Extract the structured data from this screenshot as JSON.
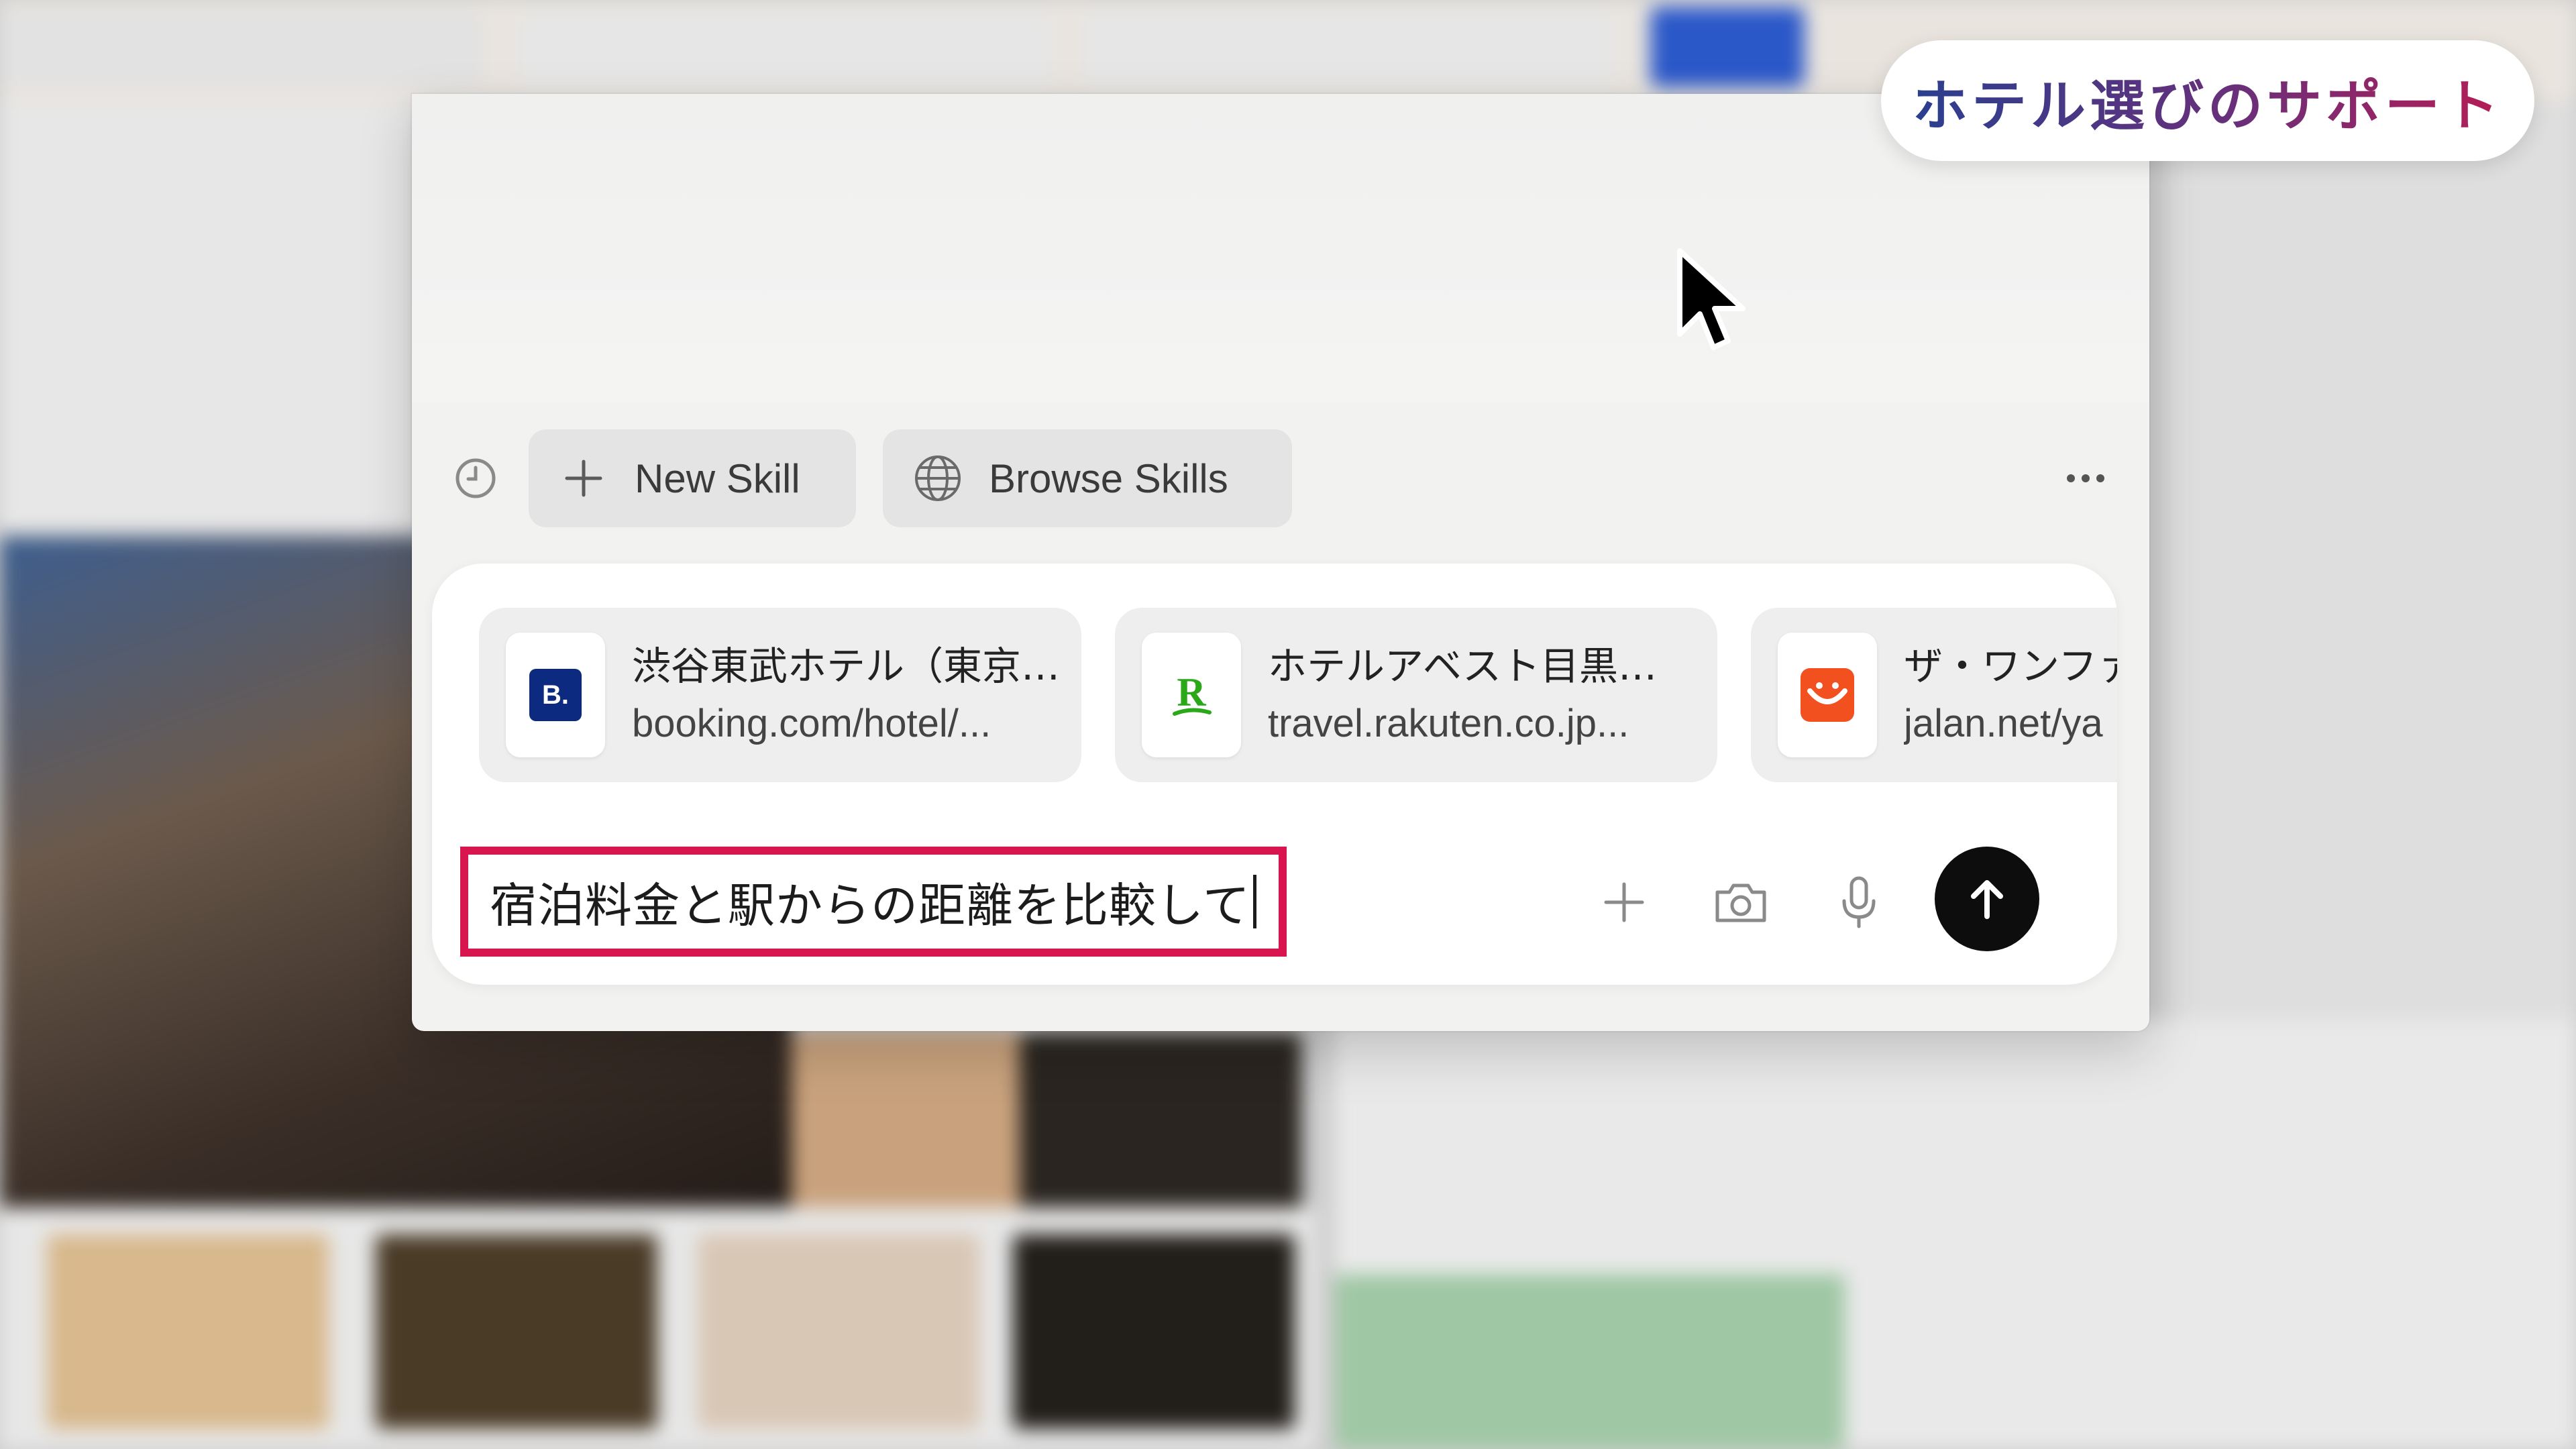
{
  "badge": {
    "title": "ホテル選びのサポート"
  },
  "toolbar": {
    "history_icon": "clock-icon",
    "new_skill_label": "New Skill",
    "browse_skills_label": "Browse Skills",
    "more_icon": "ellipsis-icon"
  },
  "tabs": [
    {
      "logo_text": "B.",
      "logo_color": "#0b2a80",
      "title": "渋谷東武ホテル（東京…",
      "url": "booking.com/hotel/..."
    },
    {
      "logo_text": "R",
      "logo_color": "#2aa81a",
      "title": "ホテルアベスト目黒…",
      "url": "travel.rakuten.co.jp..."
    },
    {
      "logo_text": "",
      "logo_color": "#f2501f",
      "title": "ザ・ワンファ",
      "url": "jalan.net/ya"
    }
  ],
  "composer": {
    "prompt_value": "宿泊料金と駅からの距離を比較して",
    "highlight_color": "#d8154f",
    "actions": [
      "plus-icon",
      "camera-icon",
      "microphone-icon",
      "send-arrow-icon"
    ]
  },
  "colors": {
    "send_button": "#0d0d0d",
    "badge_gradient_start": "#2a3f8f",
    "badge_gradient_end": "#b51d55"
  }
}
